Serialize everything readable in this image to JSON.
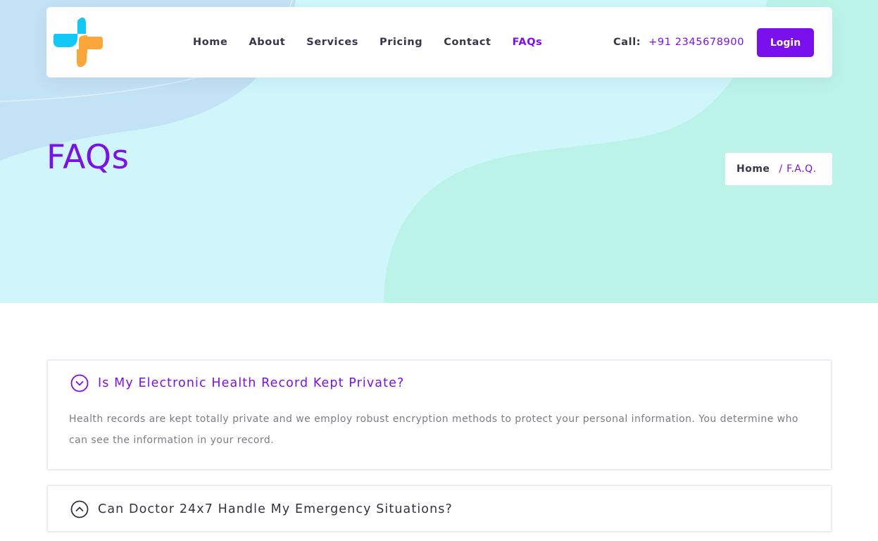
{
  "colors": {
    "accent": "#7a10ee",
    "hero_bg": "#cff7fb",
    "blob_blue": "#c4e2f5",
    "blob_mint": "#bcf3e9",
    "text_dark": "#37364a",
    "text_muted": "#7c7c86",
    "logo_blue": "#12c8f6",
    "logo_orange": "#fba63a"
  },
  "header": {
    "logo_icon": "medical-cross-logo",
    "nav": [
      {
        "label": "Home"
      },
      {
        "label": "About"
      },
      {
        "label": "Services"
      },
      {
        "label": "Pricing"
      },
      {
        "label": "Contact"
      },
      {
        "label": "FAQs",
        "active": true
      }
    ],
    "call_label": "Call:",
    "call_number": "+91 2345678900",
    "login_label": "Login"
  },
  "hero": {
    "title": "FAQs",
    "breadcrumb": {
      "home": "Home",
      "separator": "/",
      "current": "F.A.Q."
    }
  },
  "faqs": [
    {
      "question": "Is My Electronic Health Record Kept Private?",
      "answer": "Health records are kept totally private and we employ robust encryption methods to protect your personal information. You determine who can see the information in your record.",
      "expanded": true,
      "icon": "chevron-down-circle-icon"
    },
    {
      "question": "Can Doctor 24x7 Handle My Emergency Situations?",
      "expanded": false,
      "icon": "chevron-up-circle-icon"
    }
  ]
}
